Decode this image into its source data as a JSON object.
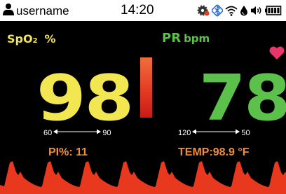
{
  "status_bar": {
    "username": "username",
    "time": "14:20",
    "icons": [
      "user-icon",
      "settings-gear-icon",
      "bluetooth-icon",
      "wifi-icon",
      "drop-icon",
      "volume-icon",
      "battery-icon"
    ]
  },
  "spo2": {
    "label_main": "SpO",
    "label_sub": "2",
    "unit": "%",
    "value": "98",
    "limit_low": "60",
    "limit_high": "90",
    "color": "#f2e651"
  },
  "pr": {
    "label": "PR",
    "unit": "bpm",
    "value": "78",
    "limit_low": "120",
    "limit_high": "50",
    "color": "#5cc14a"
  },
  "pi": {
    "label": "PI%:",
    "value": "11"
  },
  "temp": {
    "label": "TEMP:",
    "value": "98.9",
    "unit": "°F"
  },
  "colors": {
    "secondary": "#f08c3a",
    "heart": "#e8366b",
    "waveform": "#e8391f"
  }
}
